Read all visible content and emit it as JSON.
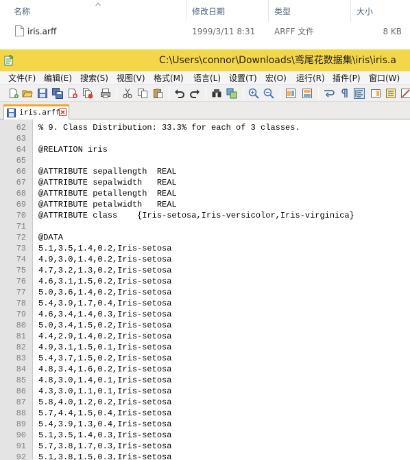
{
  "explorer": {
    "columns": {
      "name": "名称",
      "date": "修改日期",
      "type": "类型",
      "size": "大小"
    },
    "file": {
      "name": "iris.arff",
      "date": "1999/3/11 8:31",
      "type": "ARFF 文件",
      "size": "8 KB"
    }
  },
  "window": {
    "title": "C:\\Users\\connor\\Downloads\\鸢尾花数据集\\iris\\iris.a",
    "title_bar_color": "#f4d64a"
  },
  "menu": [
    "文件(F)",
    "编辑(E)",
    "搜索(S)",
    "视图(V)",
    "格式(M)",
    "语言(L)",
    "设置(T)",
    "宏(O)",
    "运行(R)",
    "插件(P)",
    "窗口(W)"
  ],
  "toolbar": {
    "buttons": [
      "new-file",
      "open-file",
      "save",
      "save-all",
      "close",
      "close-all",
      "print",
      "cut",
      "copy",
      "paste",
      "undo",
      "redo",
      "find",
      "replace",
      "zoom-in",
      "zoom-out",
      "sync-vertical",
      "sync-horizontal",
      "word-wrap",
      "show-all-chars",
      "indent-guide",
      "doc-map",
      "function-list",
      "folder-workspace"
    ]
  },
  "tab": {
    "label": "iris.arff"
  },
  "editor": {
    "lines": [
      {
        "n": "62",
        "text": "% 9. Class Distribution: 33.3% for each of 3 classes."
      },
      {
        "n": "63",
        "text": ""
      },
      {
        "n": "64",
        "text": "@RELATION iris"
      },
      {
        "n": "65",
        "text": ""
      },
      {
        "n": "66",
        "text": "@ATTRIBUTE sepallength  REAL"
      },
      {
        "n": "67",
        "text": "@ATTRIBUTE sepalwidth   REAL"
      },
      {
        "n": "68",
        "text": "@ATTRIBUTE petallength  REAL"
      },
      {
        "n": "69",
        "text": "@ATTRIBUTE petalwidth   REAL"
      },
      {
        "n": "70",
        "text": "@ATTRIBUTE class    {Iris-setosa,Iris-versicolor,Iris-virginica}"
      },
      {
        "n": "71",
        "text": ""
      },
      {
        "n": "72",
        "text": "@DATA"
      },
      {
        "n": "73",
        "text": "5.1,3.5,1.4,0.2,Iris-setosa"
      },
      {
        "n": "74",
        "text": "4.9,3.0,1.4,0.2,Iris-setosa"
      },
      {
        "n": "75",
        "text": "4.7,3.2,1.3,0.2,Iris-setosa"
      },
      {
        "n": "76",
        "text": "4.6,3.1,1.5,0.2,Iris-setosa"
      },
      {
        "n": "77",
        "text": "5.0,3.6,1.4,0.2,Iris-setosa"
      },
      {
        "n": "78",
        "text": "5.4,3.9,1.7,0.4,Iris-setosa"
      },
      {
        "n": "79",
        "text": "4.6,3.4,1.4,0.3,Iris-setosa"
      },
      {
        "n": "80",
        "text": "5.0,3.4,1.5,0.2,Iris-setosa"
      },
      {
        "n": "81",
        "text": "4.4,2.9,1.4,0.2,Iris-setosa"
      },
      {
        "n": "82",
        "text": "4.9,3.1,1.5,0.1,Iris-setosa"
      },
      {
        "n": "83",
        "text": "5.4,3.7,1.5,0.2,Iris-setosa"
      },
      {
        "n": "84",
        "text": "4.8,3.4,1.6,0.2,Iris-setosa"
      },
      {
        "n": "85",
        "text": "4.8,3.0,1.4,0.1,Iris-setosa"
      },
      {
        "n": "86",
        "text": "4.3,3.0,1.1,0.1,Iris-setosa"
      },
      {
        "n": "87",
        "text": "5.8,4.0,1.2,0.2,Iris-setosa"
      },
      {
        "n": "88",
        "text": "5.7,4.4,1.5,0.4,Iris-setosa"
      },
      {
        "n": "89",
        "text": "5.4,3.9,1.3,0.4,Iris-setosa"
      },
      {
        "n": "90",
        "text": "5.1,3.5,1.4,0.3,Iris-setosa"
      },
      {
        "n": "91",
        "text": "5.7,3.8,1.7,0.3,Iris-setosa"
      },
      {
        "n": "92",
        "text": "5.1,3.8,1.5,0.3,Iris-setosa"
      }
    ]
  }
}
